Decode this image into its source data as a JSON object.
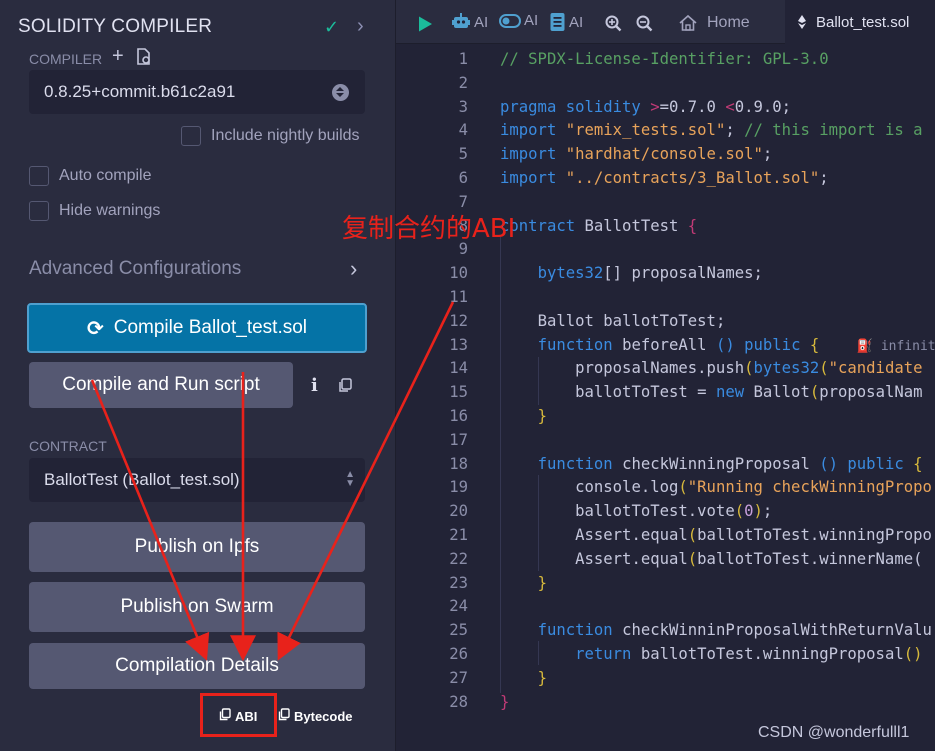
{
  "panel": {
    "title": "SOLIDITY COMPILER",
    "compiler_label": "COMPILER",
    "compiler_version": "0.8.25+commit.b61c2a91",
    "include_nightly_label": "Include nightly builds",
    "auto_compile_label": "Auto compile",
    "hide_warnings_label": "Hide warnings",
    "advanced_label": "Advanced Configurations",
    "compile_button_label": "Compile Ballot_test.sol",
    "run_script_label": "Compile and Run script",
    "info_glyph": "i",
    "contract_label": "CONTRACT",
    "contract_value": "BallotTest (Ballot_test.sol)",
    "publish_ipfs_label": "Publish on Ipfs",
    "publish_swarm_label": "Publish on Swarm",
    "compilation_details_label": "Compilation Details",
    "abi_label": "ABI",
    "bytecode_label": "Bytecode"
  },
  "annotation": {
    "text": "复制合约的ABI",
    "color": "#e8221b"
  },
  "toolbar": {
    "ai1": "AI",
    "ai2": "AI",
    "ai3": "AI",
    "home_tab": "Home",
    "file_tab": "Ballot_test.sol"
  },
  "editor": {
    "lines": [
      {
        "n": "1",
        "html": "<span class='c-comment'>// SPDX-License-Identifier: GPL-3.0</span>"
      },
      {
        "n": "2",
        "html": ""
      },
      {
        "n": "3",
        "html": "<span class='c-kw'>pragma solidity</span> <span class='c-op'>&gt;</span><span class='c-id'>=0.7.0</span> <span class='c-op'>&lt;</span><span class='c-id'>0.9.0;</span>"
      },
      {
        "n": "4",
        "html": "<span class='c-kw'>import</span> <span class='c-str'>\"remix_tests.sol\"</span><span class='c-id'>;</span> <span class='c-comment'>// this import is a</span>"
      },
      {
        "n": "5",
        "html": "<span class='c-kw'>import</span> <span class='c-str'>\"hardhat/console.sol\"</span><span class='c-id'>;</span>"
      },
      {
        "n": "6",
        "html": "<span class='c-kw'>import</span> <span class='c-str'>\"../contracts/3_Ballot.sol\"</span><span class='c-id'>;</span>"
      },
      {
        "n": "7",
        "html": ""
      },
      {
        "n": "8",
        "html": "<span class='c-kw'>contract</span> <span class='c-id'>BallotTest</span> <span class='c-brace'>{</span>"
      },
      {
        "n": "9",
        "html": ""
      },
      {
        "n": "10",
        "html": "    <span class='c-kw'>bytes32</span><span class='c-id'>[] proposalNames;</span>"
      },
      {
        "n": "11",
        "html": ""
      },
      {
        "n": "12",
        "html": "    <span class='c-id'>Ballot ballotToTest;</span>"
      },
      {
        "n": "13",
        "html": "    <span class='c-kw'>function</span> <span class='c-id'>beforeAll</span> <span class='c-kw'>()</span> <span class='c-kw'>public</span> <span class='c-paren'>{</span>    <span class='c-gas'>⛽ infinite</span>"
      },
      {
        "n": "14",
        "html": "        <span class='c-id'>proposalNames.push</span><span class='c-paren'>(</span><span class='c-kw'>bytes32</span><span class='c-paren'>(</span><span class='c-str'>\"candidate</span>"
      },
      {
        "n": "15",
        "html": "        <span class='c-id'>ballotToTest = </span><span class='c-kw'>new</span> <span class='c-id'>Ballot</span><span class='c-paren'>(</span><span class='c-id'>proposalNam</span>"
      },
      {
        "n": "16",
        "html": "    <span class='c-paren'>}</span>"
      },
      {
        "n": "17",
        "html": ""
      },
      {
        "n": "18",
        "html": "    <span class='c-kw'>function</span> <span class='c-id'>checkWinningProposal</span> <span class='c-kw'>()</span> <span class='c-kw'>public</span> <span class='c-paren'>{</span>"
      },
      {
        "n": "19",
        "html": "        <span class='c-id'>console.log</span><span class='c-paren'>(</span><span class='c-str'>\"Running checkWinningPropo</span>"
      },
      {
        "n": "20",
        "html": "        <span class='c-id'>ballotToTest.vote</span><span class='c-paren'>(</span><span class='c-num'>0</span><span class='c-paren'>)</span><span class='c-id'>;</span>"
      },
      {
        "n": "21",
        "html": "        <span class='c-id'>Assert.equal</span><span class='c-paren'>(</span><span class='c-id'>ballotToTest.winningPropo</span>"
      },
      {
        "n": "22",
        "html": "        <span class='c-id'>Assert.equal</span><span class='c-paren'>(</span><span class='c-id'>ballotToTest.winnerName(</span>"
      },
      {
        "n": "23",
        "html": "    <span class='c-paren'>}</span>"
      },
      {
        "n": "24",
        "html": ""
      },
      {
        "n": "25",
        "html": "    <span class='c-kw'>function</span> <span class='c-id'>checkWinninProposalWithReturnValu</span>"
      },
      {
        "n": "26",
        "html": "        <span class='c-kw'>return</span> <span class='c-id'>ballotToTest.winningProposal</span><span class='c-paren'>()</span>"
      },
      {
        "n": "27",
        "html": "    <span class='c-paren'>}</span>"
      },
      {
        "n": "28",
        "html": "<span class='c-brace'>}</span>"
      }
    ]
  },
  "watermark": "CSDN @wonderfulll1",
  "colors": {
    "accent": "#0573a6",
    "panel_bg": "#2a2c3f",
    "editor_bg": "#222336",
    "success": "#1bbc9b",
    "annotation": "#e8221b"
  }
}
